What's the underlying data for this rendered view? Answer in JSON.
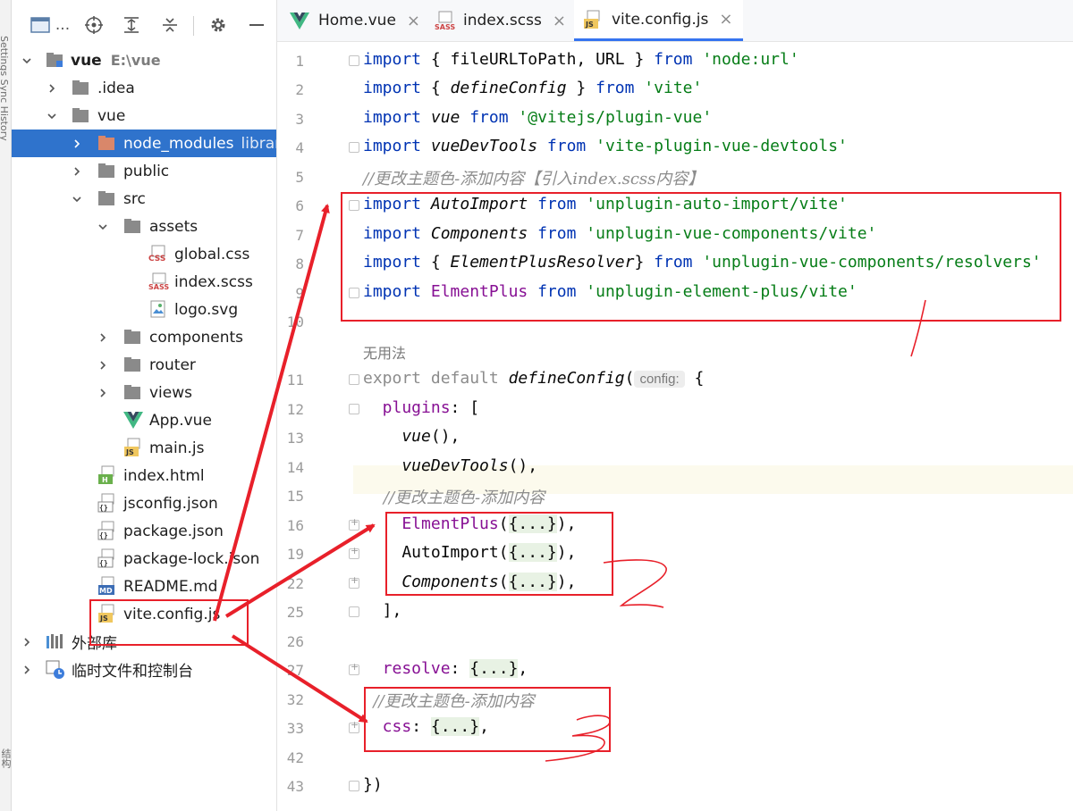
{
  "left_strip": {
    "text": "Settings Sync History",
    "bottom_text": "结构"
  },
  "project_toolbar": {
    "title": "..."
  },
  "tree": [
    {
      "label": "vue",
      "hint": "E:\\vue",
      "icon": "module-folder-icon",
      "chev": "down"
    },
    {
      "label": ".idea",
      "icon": "folder-icon",
      "chev": "right"
    },
    {
      "label": "vue",
      "icon": "folder-icon",
      "chev": "down"
    },
    {
      "label": "node_modules",
      "hint": "librar",
      "icon": "excluded-folder-icon",
      "chev": "right"
    },
    {
      "label": "public",
      "icon": "folder-icon",
      "chev": "right"
    },
    {
      "label": "src",
      "icon": "folder-icon",
      "chev": "down"
    },
    {
      "label": "assets",
      "icon": "folder-icon",
      "chev": "down"
    },
    {
      "label": "global.css",
      "icon": "css-file-icon",
      "chev": ""
    },
    {
      "label": "index.scss",
      "icon": "sass-file-icon",
      "chev": ""
    },
    {
      "label": "logo.svg",
      "icon": "image-file-icon",
      "chev": ""
    },
    {
      "label": "components",
      "icon": "folder-icon",
      "chev": "right"
    },
    {
      "label": "router",
      "icon": "folder-icon",
      "chev": "right"
    },
    {
      "label": "views",
      "icon": "folder-icon",
      "chev": "right"
    },
    {
      "label": "App.vue",
      "icon": "vue-file-icon",
      "chev": ""
    },
    {
      "label": "main.js",
      "icon": "js-file-icon",
      "chev": ""
    },
    {
      "label": "index.html",
      "icon": "html-file-icon",
      "chev": ""
    },
    {
      "label": "jsconfig.json",
      "icon": "json-file-icon",
      "chev": ""
    },
    {
      "label": "package.json",
      "icon": "json-file-icon",
      "chev": ""
    },
    {
      "label": "package-lock.json",
      "icon": "json-file-icon",
      "chev": ""
    },
    {
      "label": "README.md",
      "icon": "md-file-icon",
      "chev": ""
    },
    {
      "label": "vite.config.js",
      "icon": "js-file-icon",
      "chev": ""
    },
    {
      "label": "外部库",
      "icon": "library-icon",
      "chev": "right"
    },
    {
      "label": "临时文件和控制台",
      "icon": "scratches-icon",
      "chev": "right"
    }
  ],
  "tabs": [
    {
      "label": "Home.vue",
      "icon": "vue-file-icon"
    },
    {
      "label": "index.scss",
      "icon": "sass-file-icon"
    },
    {
      "label": "vite.config.js",
      "icon": "js-file-icon",
      "active": true
    }
  ],
  "tab_close_glyph": "×",
  "line_numbers": [
    "1",
    "2",
    "3",
    "4",
    "5",
    "6",
    "7",
    "8",
    "9",
    "10",
    "",
    "11",
    "12",
    "13",
    "14",
    "15",
    "16",
    "19",
    "22",
    "25",
    "26",
    "27",
    "32",
    "33",
    "42",
    "43"
  ],
  "code": {
    "l1": {
      "kw1": "import",
      "a": " { fileURLToPath, URL } ",
      "kw2": "from",
      "s": " 'node:url'"
    },
    "l2": {
      "kw1": "import",
      "a": " { ",
      "fn": "defineConfig",
      "b": " } ",
      "kw2": "from",
      "s": " 'vite'"
    },
    "l3": {
      "kw1": "import",
      "fn": " vue ",
      "kw2": "from",
      "s": " '@vitejs/plugin-vue'"
    },
    "l4": {
      "kw1": "import",
      "fn": " vueDevTools ",
      "kw2": "from",
      "s": " 'vite-plugin-vue-devtools'"
    },
    "l5": {
      "c": "//更改主题色-添加内容【引入index.scss内容】"
    },
    "l6": {
      "kw1": "import",
      "fn": " AutoImport ",
      "kw2": "from",
      "s": " 'unplugin-auto-import/vite'"
    },
    "l7": {
      "kw1": "import",
      "fn": " Components ",
      "kw2": "from",
      "s": " 'unplugin-vue-components/vite'"
    },
    "l8": {
      "kw1": "import",
      "a": " { ",
      "fn": "ElementPlusResolver",
      "b": "} ",
      "kw2": "from",
      "s": " 'unplugin-vue-components/resolvers'"
    },
    "l9": {
      "kw1": "import",
      "m": " ElmentPlus ",
      "kw2": "from",
      "s": " 'unplugin-element-plus/vite'"
    },
    "usage": "无用法",
    "l11": {
      "kw1": "export default ",
      "fn": "defineConfig",
      "a": "(",
      "hint": "config:",
      "b": " {"
    },
    "l12": {
      "p": "  plugins",
      "a": ": ["
    },
    "l13": {
      "fn": "    vue",
      "a": "(),"
    },
    "l14": {
      "fn": "    vueDevTools",
      "a": "(),"
    },
    "l15": {
      "c": "    //更改主题色-添加内容"
    },
    "l16": {
      "m": "    ElmentPlus",
      "a": "(",
      "f": "{...}",
      "b": "),"
    },
    "l19": {
      "n": "    AutoImport",
      "a": "(",
      "f": "{...}",
      "b": "),"
    },
    "l22": {
      "fn": "    Components",
      "a": "(",
      "f": "{...}",
      "b": "),"
    },
    "l25": {
      "a": "  ],"
    },
    "l27": {
      "p": "  resolve",
      "a": ": ",
      "f": "{...}",
      "b": ","
    },
    "l32": {
      "c": "  //更改主题色-添加内容"
    },
    "l33": {
      "p": "  css",
      "a": ": ",
      "f": "{...}",
      "b": ","
    },
    "l43": {
      "a": "})"
    }
  },
  "colors": {
    "keyword": "#0033b3",
    "string": "#067d17",
    "property": "#871094",
    "comment": "#8c8c8c",
    "selection": "#2f73cc",
    "annotation": "#e8202a"
  }
}
